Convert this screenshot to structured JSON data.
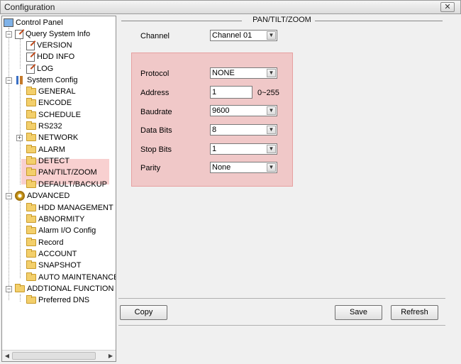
{
  "window": {
    "title": "Configuration",
    "close_label": "✕"
  },
  "tree": {
    "root": "Control Panel",
    "query": "Query System Info",
    "query_items": [
      "VERSION",
      "HDD INFO",
      "LOG"
    ],
    "system": "System Config",
    "system_items": [
      "GENERAL",
      "ENCODE",
      "SCHEDULE",
      "RS232",
      "NETWORK",
      "ALARM",
      "DETECT",
      "PAN/TILT/ZOOM",
      "DEFAULT/BACKUP"
    ],
    "advanced": "ADVANCED",
    "advanced_items": [
      "HDD MANAGEMENT",
      "ABNORMITY",
      "Alarm I/O Config",
      "Record",
      "ACCOUNT",
      "SNAPSHOT",
      "AUTO MAINTENANCE"
    ],
    "additional": "ADDTIONAL FUNCTION",
    "additional_items": [
      "Preferred DNS"
    ],
    "selected": "PAN/TILT/ZOOM"
  },
  "panel": {
    "title": "PAN/TILT/ZOOM",
    "channel": {
      "label": "Channel",
      "value": "Channel 01"
    },
    "protocol": {
      "label": "Protocol",
      "value": "NONE"
    },
    "address": {
      "label": "Address",
      "value": "1",
      "range": "0~255"
    },
    "baudrate": {
      "label": "Baudrate",
      "value": "9600"
    },
    "databits": {
      "label": "Data Bits",
      "value": "8"
    },
    "stopbits": {
      "label": "Stop Bits",
      "value": "1"
    },
    "parity": {
      "label": "Parity",
      "value": "None"
    }
  },
  "buttons": {
    "copy": "Copy",
    "save": "Save",
    "refresh": "Refresh"
  },
  "icons": {
    "dropdown": "▼",
    "plus": "+",
    "minus": "−",
    "scroll_left": "◀",
    "scroll_right": "▶"
  },
  "colors": {
    "highlight": "#f09696"
  }
}
